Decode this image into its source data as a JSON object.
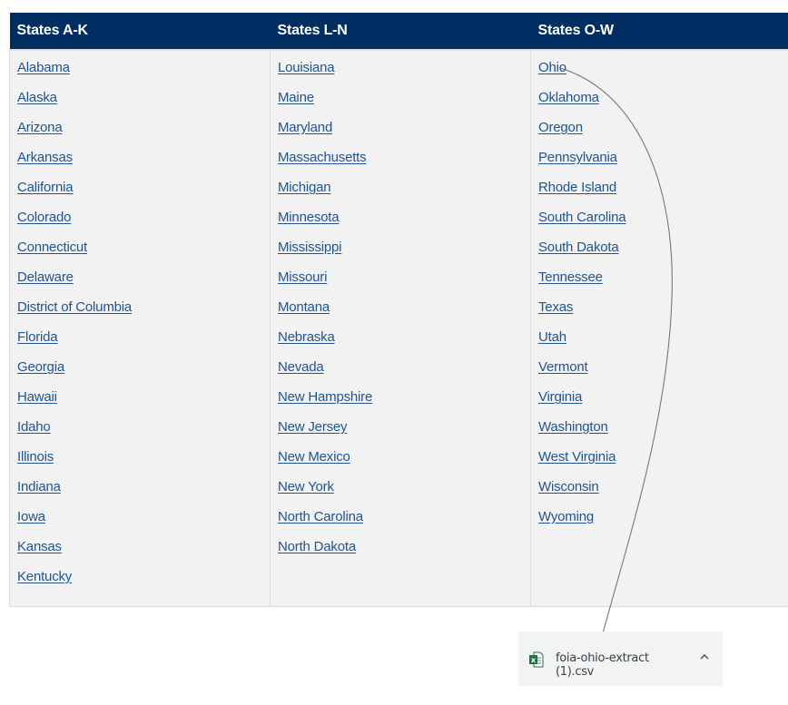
{
  "table": {
    "columns": [
      {
        "header": "States A-K",
        "states": [
          "Alabama",
          "Alaska",
          "Arizona",
          "Arkansas",
          "California",
          "Colorado",
          "Connecticut",
          "Delaware",
          "District of Columbia",
          "Florida",
          "Georgia",
          "Hawaii",
          "Idaho",
          "Illinois",
          "Indiana",
          "Iowa",
          "Kansas",
          "Kentucky"
        ]
      },
      {
        "header": "States L-N",
        "states": [
          "Louisiana",
          "Maine",
          "Maryland",
          "Massachusetts",
          "Michigan",
          "Minnesota",
          "Mississippi",
          "Missouri",
          "Montana",
          "Nebraska",
          "Nevada",
          "New Hampshire",
          "New Jersey",
          "New Mexico",
          "New York",
          "North Carolina",
          "North Dakota"
        ]
      },
      {
        "header": "States O-W",
        "states": [
          "Ohio",
          "Oklahoma",
          "Oregon",
          "Pennsylvania",
          "Rhode Island",
          "South Carolina",
          "South Dakota",
          "Tennessee",
          "Texas",
          "Utah",
          "Vermont",
          "Virginia",
          "Washington",
          "West Virginia",
          "Wisconsin",
          "Wyoming"
        ]
      }
    ]
  },
  "colors": {
    "header_bg": "#002d62",
    "link": "#205493",
    "cell_bg": "#f2f2f2",
    "annotation_line": "#777777"
  },
  "annotation": {
    "from": "Ohio",
    "to": "download-item"
  },
  "download": {
    "icon": "excel-file-icon",
    "filename": "foia-ohio-extract (1).csv",
    "menu_icon": "chevron-up-icon"
  }
}
